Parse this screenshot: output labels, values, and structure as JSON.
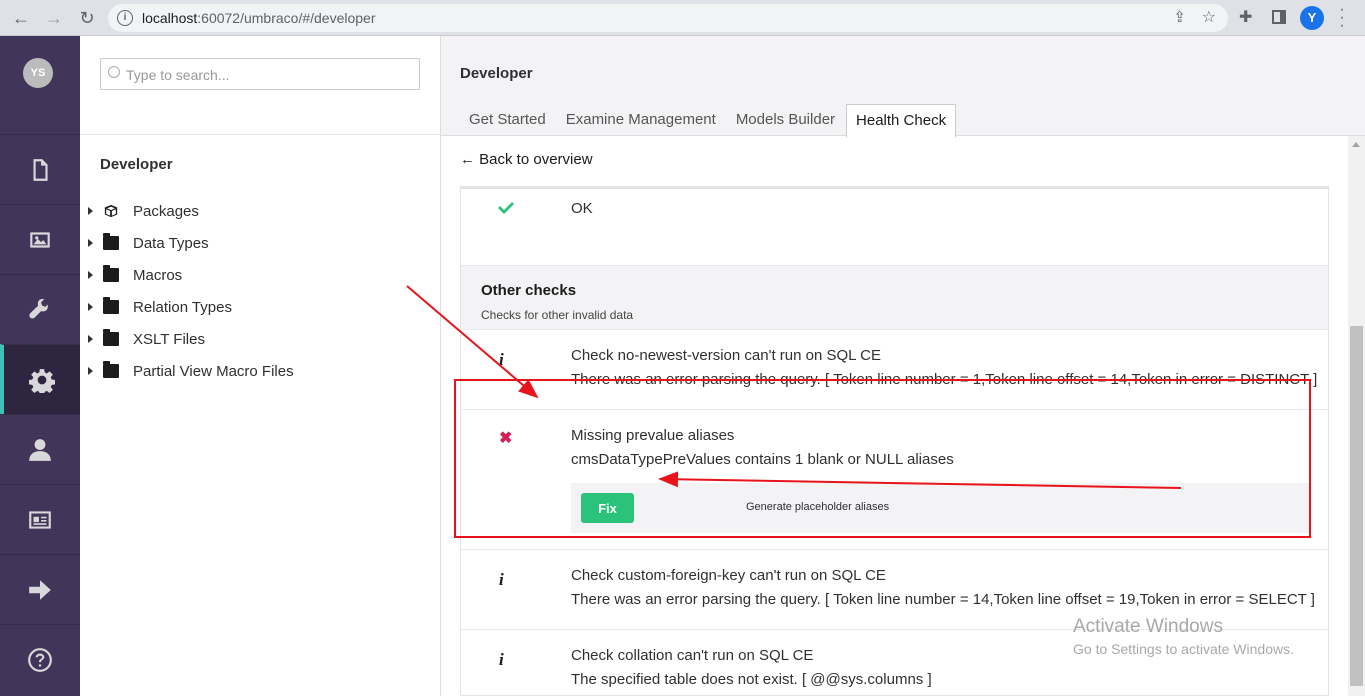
{
  "browser": {
    "url_host": "localhost",
    "url_rest": ":60072/umbraco/#/developer",
    "profile_initial": "Y",
    "icons": [
      "back-icon",
      "forward-icon",
      "reload-icon",
      "info-icon",
      "share-icon",
      "star-icon",
      "extensions-icon",
      "side-panel-icon",
      "menu-icon"
    ]
  },
  "rail": {
    "user_initials": "YS",
    "sections": [
      "content",
      "media",
      "settings",
      "developer",
      "users",
      "members",
      "forms",
      "help"
    ]
  },
  "tree": {
    "search_placeholder": "Type to search...",
    "title": "Developer",
    "items": [
      {
        "label": "Packages",
        "icon": "package-icon"
      },
      {
        "label": "Data Types",
        "icon": "folder-icon"
      },
      {
        "label": "Macros",
        "icon": "folder-icon"
      },
      {
        "label": "Relation Types",
        "icon": "folder-icon"
      },
      {
        "label": "XSLT Files",
        "icon": "folder-icon"
      },
      {
        "label": "Partial View Macro Files",
        "icon": "folder-icon"
      }
    ]
  },
  "main": {
    "title": "Developer",
    "tabs": [
      {
        "label": "Get Started",
        "active": false
      },
      {
        "label": "Examine Management",
        "active": false
      },
      {
        "label": "Models Builder",
        "active": false
      },
      {
        "label": "Health Check",
        "active": true
      }
    ],
    "back_link": "← Back to overview",
    "ok_label": "OK",
    "group": {
      "title": "Other checks",
      "description": "Checks for other invalid data"
    },
    "checks": [
      {
        "status": "info",
        "name": "Check no-newest-version can't run on SQL CE",
        "message": "There was an error parsing the query. [ Token line number = 1,Token line offset = 14,Token in error = DISTINCT ]"
      },
      {
        "status": "error",
        "name": "Missing prevalue aliases",
        "message": "cmsDataTypePreValues contains 1 blank or NULL aliases",
        "fix_label": "Fix",
        "fix_description": "Generate placeholder aliases"
      },
      {
        "status": "info",
        "name": "Check custom-foreign-key can't run on SQL CE",
        "message": "There was an error parsing the query. [ Token line number = 14,Token line offset = 19,Token in error = SELECT ]"
      },
      {
        "status": "info",
        "name": "Check collation can't run on SQL CE",
        "message": "The specified table does not exist. [ @@sys.columns ]"
      }
    ]
  },
  "watermark": {
    "line1": "Activate Windows",
    "line2": "Go to Settings to activate Windows."
  },
  "colors": {
    "rail_bg": "#413659",
    "accent": "#3fc1b7",
    "fix_button": "#2bc37c",
    "error": "#d42054",
    "ok": "#2bc37c",
    "annotation": "#e8131b"
  }
}
